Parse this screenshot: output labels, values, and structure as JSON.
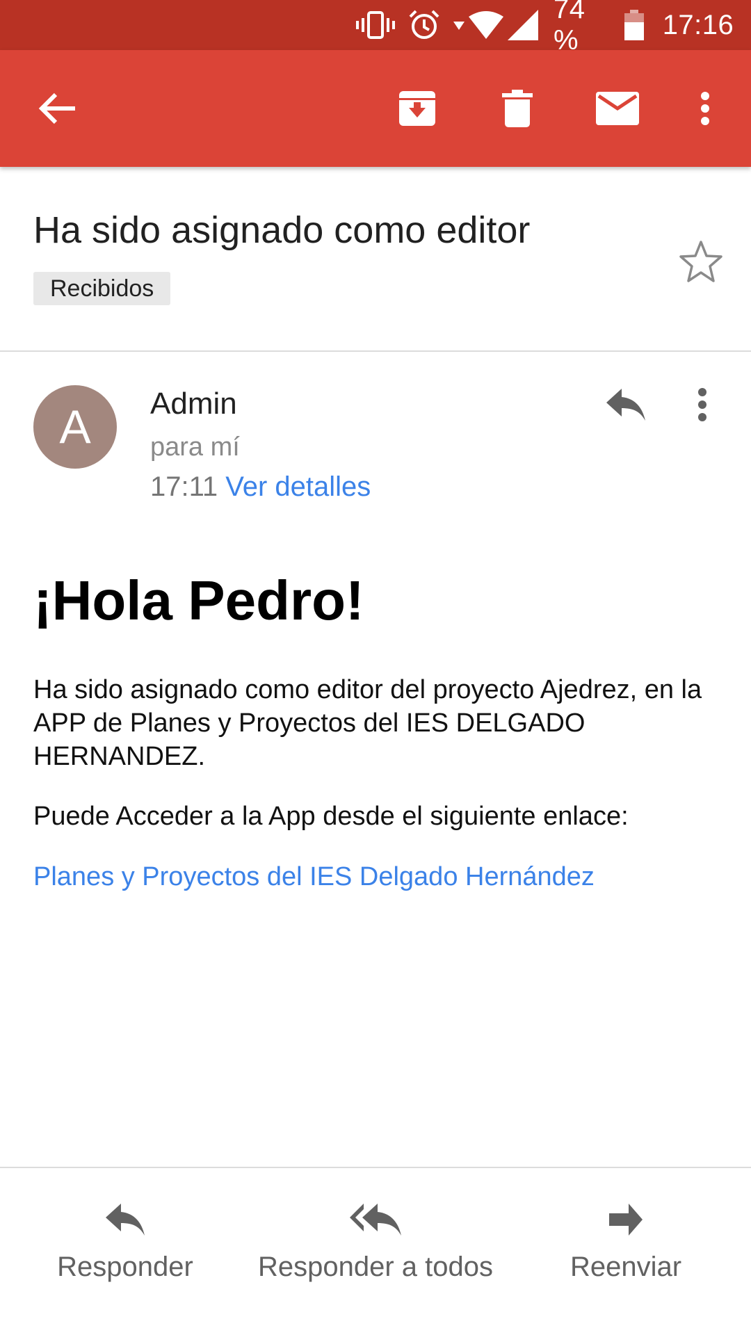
{
  "status_bar": {
    "battery_percent": "74 %",
    "time": "17:16",
    "icons": [
      "vibrate-icon",
      "alarm-icon",
      "wifi-icon",
      "signal-icon",
      "battery-icon"
    ]
  },
  "toolbar": {
    "icons": [
      "back-arrow-icon",
      "archive-icon",
      "delete-icon",
      "mark-unread-icon",
      "more-vert-icon"
    ]
  },
  "email": {
    "subject": "Ha sido asignado como editor",
    "label": "Recibidos",
    "sender": {
      "initial": "A",
      "name": "Admin",
      "recipient": "para mí",
      "time": "17:11",
      "details_link": "Ver detalles"
    },
    "body": {
      "greeting": "¡Hola Pedro!",
      "paragraph1": "Ha sido asignado como editor del proyecto Ajedrez, en la APP de Planes y Proyectos del IES DELGADO HERNANDEZ.",
      "paragraph2": "Puede Acceder a la App desde el siguiente enlace:",
      "link": "Planes y Proyectos del IES Delgado Hernández"
    }
  },
  "actions": {
    "reply": "Responder",
    "reply_all": "Responder a todos",
    "forward": "Reenviar"
  },
  "colors": {
    "status_bar": "#b83224",
    "app_bar": "#db4437",
    "link": "#3b82e8",
    "avatar": "#a3877e"
  }
}
